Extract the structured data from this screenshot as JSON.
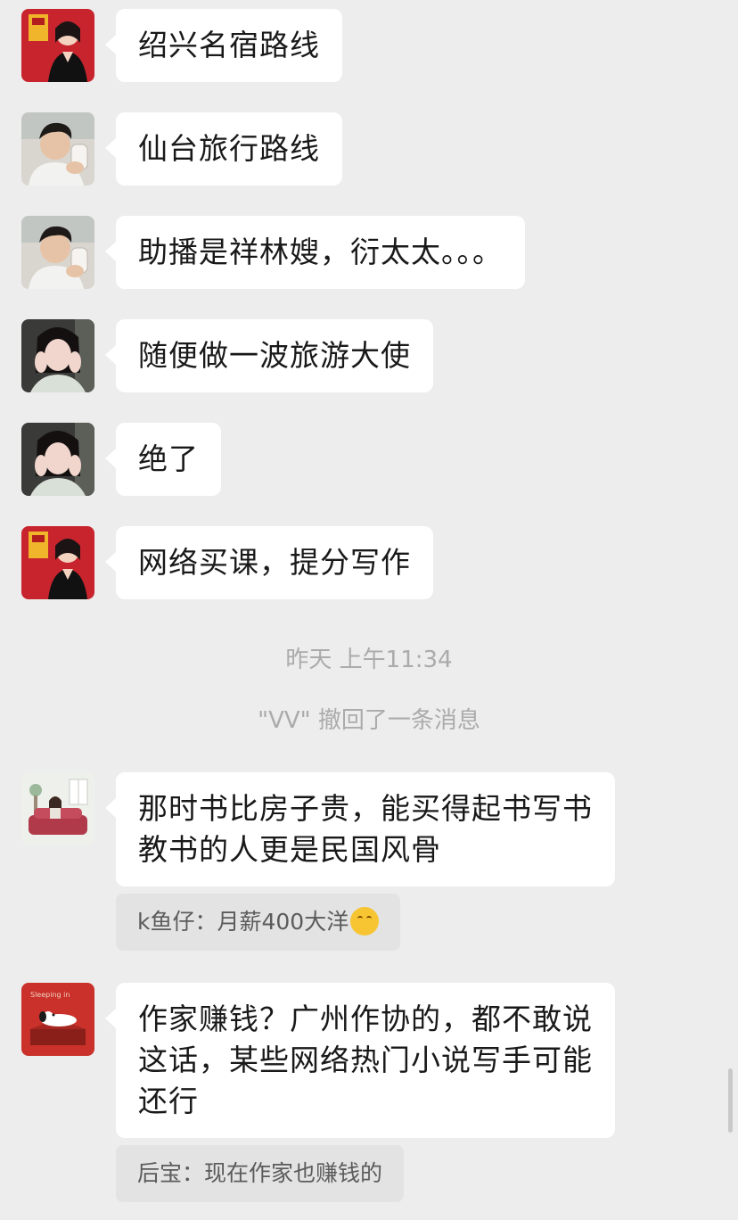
{
  "messages": [
    {
      "text": "绍兴名宿路线"
    },
    {
      "text": "仙台旅行路线"
    },
    {
      "text": "助播是祥林嫂，衍太太。。。"
    },
    {
      "text": "随便做一波旅游大使"
    },
    {
      "text": "绝了"
    },
    {
      "text": "网络买课，提分写作"
    }
  ],
  "system": {
    "timestamp": "昨天 上午11:34",
    "recall_notice": "\"VV\" 撤回了一条消息"
  },
  "later_messages": [
    {
      "text": "那时书比房子贵，能买得起书写书\n教书的人更是民国风骨",
      "quote": "k鱼仔：月薪400大洋"
    },
    {
      "text": "作家赚钱？广州作协的，都不敢说\n这话，某些网络热门小说写手可能\n还行",
      "quote": "后宝：现在作家也赚钱的"
    }
  ],
  "avatars": {
    "snoopy_caption": "Sleeping in"
  },
  "colors": {
    "background": "#ededed",
    "bubble": "#ffffff",
    "quote_bg": "#e3e3e3",
    "system_text": "#ababab"
  }
}
